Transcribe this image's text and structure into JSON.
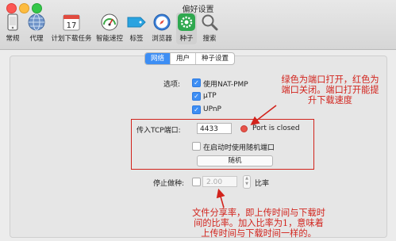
{
  "window": {
    "title": "偏好设置"
  },
  "toolbar": [
    {
      "label": "常规",
      "icon": "phone-icon"
    },
    {
      "label": "代理",
      "icon": "globe-icon"
    },
    {
      "label": "计划下载任务",
      "icon": "calendar-icon",
      "badge": "17"
    },
    {
      "label": "智能速控",
      "icon": "speedometer-icon"
    },
    {
      "label": "标签",
      "icon": "tag-icon"
    },
    {
      "label": "浏览器",
      "icon": "compass-icon"
    },
    {
      "label": "种子",
      "icon": "gear-icon"
    },
    {
      "label": "搜索",
      "icon": "magnifier-icon"
    }
  ],
  "tabs": [
    "网络",
    "用户",
    "种子设置"
  ],
  "options": {
    "label": "选项:",
    "items": [
      {
        "label": "使用NAT-PMP",
        "checked": true
      },
      {
        "label": "µTP",
        "checked": true
      },
      {
        "label": "UPnP",
        "checked": true
      }
    ]
  },
  "port": {
    "label": "传入TCP端口:",
    "value": "4433",
    "status": "Port is closed",
    "random_on_start": "在启动时使用随机端口",
    "random_button": "随机"
  },
  "seeding": {
    "label": "停止做种:",
    "value": "2.00",
    "unit": "比率"
  },
  "annotations": {
    "port_note": [
      "绿色为端口打开，红色为",
      "端口关闭。端口打开能提",
      "升下载速度"
    ],
    "ratio_note": [
      "文件分享率，即上传时间与下载时",
      "间的比率。加入比率为1，意味着",
      "上传时间与下载时间一样的。"
    ]
  },
  "colors": {
    "accent": "#3d8ef4",
    "annotation": "#d2231c",
    "closed_dot": "#e8544a"
  }
}
